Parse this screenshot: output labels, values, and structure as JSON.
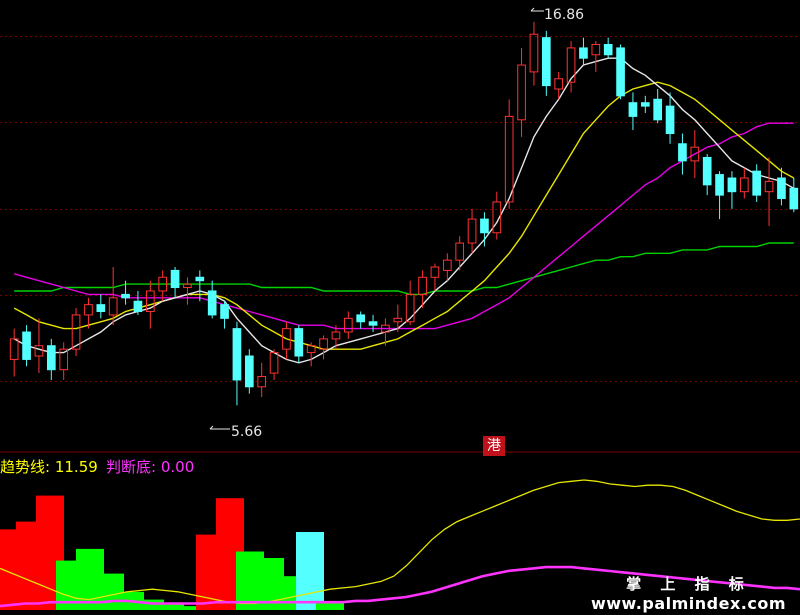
{
  "indicator": {
    "line1_name": "趋势线",
    "line1_value": "11.59",
    "line2_name": "判断底",
    "line2_value": "0.00"
  },
  "badge_text": "港",
  "watermark": {
    "title": "掌 上 指 标",
    "url": "www.palmindex.com"
  },
  "chart_data": [
    {
      "type": "candlestick",
      "annotations": {
        "high": "16.86",
        "low": "5.66"
      },
      "ylim": [
        4.5,
        17.5
      ],
      "colors": {
        "up": "#ff3232",
        "down": "#54ffff",
        "ma_white": "#e6e6e6",
        "ma_yellow": "#e6e600",
        "ma_magenta": "#e600e6",
        "ma_green": "#00d200",
        "grid": "#7a0000"
      },
      "candles": [
        {
          "o": 7.0,
          "h": 7.9,
          "l": 6.5,
          "c": 7.6
        },
        {
          "o": 7.8,
          "h": 8.0,
          "l": 6.8,
          "c": 7.0
        },
        {
          "o": 7.1,
          "h": 8.2,
          "l": 6.6,
          "c": 7.4
        },
        {
          "o": 7.4,
          "h": 7.6,
          "l": 6.4,
          "c": 6.7
        },
        {
          "o": 6.7,
          "h": 7.5,
          "l": 6.4,
          "c": 7.3
        },
        {
          "o": 7.3,
          "h": 8.5,
          "l": 7.1,
          "c": 8.3
        },
        {
          "o": 8.3,
          "h": 8.8,
          "l": 7.9,
          "c": 8.6
        },
        {
          "o": 8.6,
          "h": 8.9,
          "l": 8.2,
          "c": 8.4
        },
        {
          "o": 8.3,
          "h": 9.7,
          "l": 8.0,
          "c": 8.8
        },
        {
          "o": 8.9,
          "h": 9.3,
          "l": 8.6,
          "c": 8.8
        },
        {
          "o": 8.7,
          "h": 9.0,
          "l": 8.3,
          "c": 8.4
        },
        {
          "o": 8.4,
          "h": 9.3,
          "l": 7.9,
          "c": 9.0
        },
        {
          "o": 9.0,
          "h": 9.6,
          "l": 8.7,
          "c": 9.4
        },
        {
          "o": 9.6,
          "h": 9.7,
          "l": 8.8,
          "c": 9.1
        },
        {
          "o": 9.1,
          "h": 9.4,
          "l": 8.6,
          "c": 9.2
        },
        {
          "o": 9.4,
          "h": 9.6,
          "l": 8.7,
          "c": 9.3
        },
        {
          "o": 9.0,
          "h": 9.3,
          "l": 8.2,
          "c": 8.3
        },
        {
          "o": 8.6,
          "h": 8.7,
          "l": 7.9,
          "c": 8.2
        },
        {
          "o": 7.9,
          "h": 8.1,
          "l": 5.66,
          "c": 6.4
        },
        {
          "o": 7.1,
          "h": 7.3,
          "l": 6.0,
          "c": 6.2
        },
        {
          "o": 6.2,
          "h": 6.9,
          "l": 5.9,
          "c": 6.5
        },
        {
          "o": 6.6,
          "h": 7.3,
          "l": 6.4,
          "c": 7.2
        },
        {
          "o": 7.3,
          "h": 8.1,
          "l": 7.0,
          "c": 7.9
        },
        {
          "o": 7.9,
          "h": 8.0,
          "l": 6.9,
          "c": 7.1
        },
        {
          "o": 7.2,
          "h": 7.5,
          "l": 6.8,
          "c": 7.4
        },
        {
          "o": 7.3,
          "h": 7.7,
          "l": 7.0,
          "c": 7.6
        },
        {
          "o": 7.6,
          "h": 8.0,
          "l": 7.3,
          "c": 7.8
        },
        {
          "o": 7.8,
          "h": 8.4,
          "l": 7.6,
          "c": 8.2
        },
        {
          "o": 8.3,
          "h": 8.4,
          "l": 7.9,
          "c": 8.1
        },
        {
          "o": 8.1,
          "h": 8.3,
          "l": 7.8,
          "c": 8.0
        },
        {
          "o": 7.8,
          "h": 8.2,
          "l": 7.4,
          "c": 8.0
        },
        {
          "o": 8.1,
          "h": 8.6,
          "l": 7.8,
          "c": 8.2
        },
        {
          "o": 8.1,
          "h": 9.3,
          "l": 8.0,
          "c": 8.9
        },
        {
          "o": 8.9,
          "h": 9.6,
          "l": 8.5,
          "c": 9.4
        },
        {
          "o": 9.4,
          "h": 9.8,
          "l": 9.0,
          "c": 9.7
        },
        {
          "o": 9.6,
          "h": 10.1,
          "l": 9.3,
          "c": 9.9
        },
        {
          "o": 9.9,
          "h": 10.6,
          "l": 9.6,
          "c": 10.4
        },
        {
          "o": 10.4,
          "h": 11.4,
          "l": 10.1,
          "c": 11.1
        },
        {
          "o": 11.1,
          "h": 11.3,
          "l": 10.3,
          "c": 10.7
        },
        {
          "o": 10.7,
          "h": 11.9,
          "l": 10.5,
          "c": 11.6
        },
        {
          "o": 11.6,
          "h": 14.6,
          "l": 11.4,
          "c": 14.1
        },
        {
          "o": 14.0,
          "h": 16.1,
          "l": 13.5,
          "c": 15.6
        },
        {
          "o": 15.4,
          "h": 16.86,
          "l": 15.0,
          "c": 16.5
        },
        {
          "o": 16.4,
          "h": 16.6,
          "l": 14.7,
          "c": 15.0
        },
        {
          "o": 14.9,
          "h": 15.4,
          "l": 14.6,
          "c": 15.2
        },
        {
          "o": 15.1,
          "h": 16.3,
          "l": 14.8,
          "c": 16.1
        },
        {
          "o": 16.1,
          "h": 16.4,
          "l": 15.6,
          "c": 15.8
        },
        {
          "o": 15.9,
          "h": 16.3,
          "l": 15.4,
          "c": 16.2
        },
        {
          "o": 16.2,
          "h": 16.4,
          "l": 15.8,
          "c": 15.9
        },
        {
          "o": 16.1,
          "h": 16.2,
          "l": 14.6,
          "c": 14.7
        },
        {
          "o": 14.5,
          "h": 14.8,
          "l": 13.7,
          "c": 14.1
        },
        {
          "o": 14.5,
          "h": 14.7,
          "l": 14.2,
          "c": 14.4
        },
        {
          "o": 14.6,
          "h": 14.9,
          "l": 13.9,
          "c": 14.0
        },
        {
          "o": 14.4,
          "h": 14.8,
          "l": 13.3,
          "c": 13.6
        },
        {
          "o": 13.3,
          "h": 13.6,
          "l": 12.4,
          "c": 12.8
        },
        {
          "o": 12.8,
          "h": 13.7,
          "l": 12.3,
          "c": 13.2
        },
        {
          "o": 12.9,
          "h": 13.0,
          "l": 11.8,
          "c": 12.1
        },
        {
          "o": 12.4,
          "h": 12.5,
          "l": 11.1,
          "c": 11.8
        },
        {
          "o": 12.3,
          "h": 12.5,
          "l": 11.4,
          "c": 11.9
        },
        {
          "o": 11.9,
          "h": 12.6,
          "l": 11.7,
          "c": 12.3
        },
        {
          "o": 12.5,
          "h": 12.7,
          "l": 11.6,
          "c": 11.8
        },
        {
          "o": 11.9,
          "h": 12.9,
          "l": 10.9,
          "c": 12.2
        },
        {
          "o": 12.3,
          "h": 12.6,
          "l": 11.5,
          "c": 11.7
        },
        {
          "o": 12.0,
          "h": 12.3,
          "l": 11.3,
          "c": 11.4
        }
      ],
      "ma_white": [
        7.6,
        7.4,
        7.3,
        7.2,
        7.2,
        7.4,
        7.6,
        7.8,
        8.1,
        8.3,
        8.4,
        8.5,
        8.7,
        8.8,
        8.9,
        9.0,
        8.9,
        8.7,
        8.2,
        7.8,
        7.4,
        7.2,
        7.0,
        6.9,
        7.0,
        7.2,
        7.4,
        7.5,
        7.6,
        7.7,
        7.8,
        7.9,
        8.2,
        8.6,
        9.0,
        9.3,
        9.7,
        10.1,
        10.5,
        11.0,
        11.7,
        12.6,
        13.5,
        14.1,
        14.6,
        15.2,
        15.6,
        15.7,
        15.8,
        15.8,
        15.5,
        15.3,
        15.0,
        14.7,
        14.3,
        14.0,
        13.6,
        13.2,
        12.8,
        12.6,
        12.4,
        12.3,
        12.2,
        12.0
      ],
      "ma_yellow": [
        8.5,
        8.3,
        8.1,
        8.0,
        7.9,
        7.9,
        8.0,
        8.1,
        8.2,
        8.4,
        8.5,
        8.6,
        8.7,
        8.8,
        8.9,
        8.9,
        8.9,
        8.8,
        8.6,
        8.3,
        8.0,
        7.8,
        7.6,
        7.5,
        7.4,
        7.3,
        7.3,
        7.3,
        7.3,
        7.4,
        7.5,
        7.6,
        7.8,
        8.0,
        8.2,
        8.4,
        8.7,
        9.0,
        9.3,
        9.7,
        10.1,
        10.6,
        11.2,
        11.8,
        12.4,
        13.0,
        13.6,
        14.0,
        14.4,
        14.7,
        14.9,
        15.0,
        15.1,
        15.0,
        14.8,
        14.6,
        14.3,
        14.0,
        13.7,
        13.4,
        13.1,
        12.8,
        12.5,
        12.3
      ],
      "ma_magenta": [
        9.5,
        9.4,
        9.3,
        9.2,
        9.1,
        9.0,
        8.9,
        8.9,
        8.9,
        8.8,
        8.8,
        8.8,
        8.8,
        8.8,
        8.8,
        8.8,
        8.7,
        8.6,
        8.5,
        8.4,
        8.3,
        8.2,
        8.1,
        8.0,
        8.0,
        8.0,
        7.9,
        7.9,
        7.9,
        7.9,
        7.9,
        7.9,
        7.9,
        7.9,
        7.9,
        8.0,
        8.1,
        8.2,
        8.4,
        8.6,
        8.8,
        9.1,
        9.4,
        9.7,
        10.0,
        10.3,
        10.6,
        10.9,
        11.2,
        11.5,
        11.8,
        12.1,
        12.3,
        12.6,
        12.8,
        13.0,
        13.2,
        13.3,
        13.5,
        13.6,
        13.8,
        13.9,
        13.9,
        13.9
      ],
      "ma_green": [
        9.0,
        9.0,
        9.0,
        9.0,
        9.1,
        9.1,
        9.1,
        9.1,
        9.1,
        9.2,
        9.2,
        9.2,
        9.2,
        9.2,
        9.2,
        9.2,
        9.2,
        9.2,
        9.2,
        9.2,
        9.1,
        9.1,
        9.1,
        9.1,
        9.1,
        9.0,
        9.0,
        9.0,
        9.0,
        9.0,
        9.0,
        9.0,
        8.9,
        8.9,
        9.0,
        9.0,
        9.0,
        9.0,
        9.1,
        9.1,
        9.2,
        9.3,
        9.4,
        9.5,
        9.6,
        9.7,
        9.8,
        9.9,
        9.9,
        10.0,
        10.0,
        10.1,
        10.1,
        10.1,
        10.2,
        10.2,
        10.2,
        10.3,
        10.3,
        10.3,
        10.3,
        10.4,
        10.4,
        10.4
      ]
    },
    {
      "type": "area",
      "ylim": [
        0,
        100
      ],
      "colors": {
        "trend": "#e6e600",
        "bottom": "#ff33ff",
        "red": "#ff0000",
        "green": "#00ff00",
        "cyan": "#54ffff"
      },
      "trend_line": [
        32,
        28,
        24,
        20,
        16,
        12,
        9,
        8,
        10,
        12,
        14,
        15,
        16,
        15,
        14,
        12,
        10,
        8,
        6,
        5,
        5,
        6,
        8,
        10,
        12,
        14,
        16,
        17,
        18,
        20,
        22,
        26,
        34,
        44,
        54,
        62,
        68,
        72,
        76,
        80,
        84,
        88,
        92,
        95,
        98,
        99,
        100,
        99,
        97,
        96,
        95,
        96,
        96,
        95,
        92,
        88,
        84,
        80,
        76,
        73,
        70,
        69,
        69,
        70
      ],
      "bottom_line": [
        3,
        4,
        5,
        5,
        6,
        6,
        6,
        6,
        6,
        7,
        7,
        6,
        5,
        5,
        5,
        5,
        5,
        6,
        6,
        6,
        6,
        6,
        6,
        6,
        6,
        6,
        6,
        6,
        7,
        7,
        8,
        9,
        10,
        12,
        14,
        17,
        20,
        23,
        26,
        28,
        30,
        31,
        32,
        33,
        33,
        33,
        32,
        31,
        30,
        29,
        28,
        27,
        26,
        25,
        24,
        23,
        22,
        21,
        20,
        19,
        18,
        17,
        17,
        16
      ],
      "bars": [
        {
          "color": "red",
          "value": 62
        },
        {
          "color": "red",
          "value": 68
        },
        {
          "color": "red",
          "value": 88
        },
        {
          "color": "green",
          "value": 38
        },
        {
          "color": "green",
          "value": 47
        },
        {
          "color": "green",
          "value": 28
        },
        {
          "color": "green",
          "value": 14
        },
        {
          "color": "green",
          "value": 8
        },
        {
          "color": "green",
          "value": 5
        },
        {
          "color": "green",
          "value": 3
        },
        {
          "color": "red",
          "value": 58
        },
        {
          "color": "red",
          "value": 86
        },
        {
          "color": "green",
          "value": 45
        },
        {
          "color": "green",
          "value": 40
        },
        {
          "color": "green",
          "value": 26
        },
        {
          "color": "cyan",
          "value": 60
        },
        {
          "color": "green",
          "value": 6
        }
      ]
    }
  ]
}
